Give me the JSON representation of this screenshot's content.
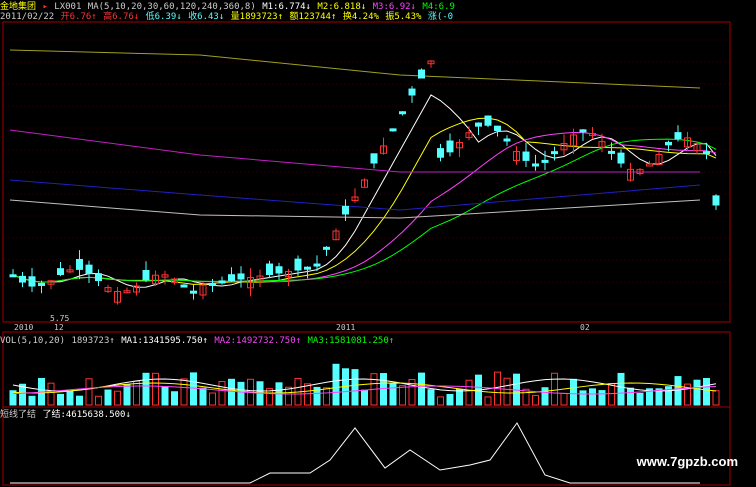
{
  "header": {
    "name": "金地集团",
    "indicator": "LX001",
    "ma_params": "MA(5,10,20,30,60,120,240,360,8)",
    "m1": "M1:6.774↓",
    "m2": "M2:6.818↓",
    "m3": "M3:6.92↓",
    "m4": "M4:6.9",
    "date": "2011/02/22",
    "open": "开6.76↑",
    "high": "高6.76↓",
    "low": "低6.39↓",
    "close": "收6.43↓",
    "volume": "量1893723↑",
    "amount": "额123744↑",
    "turnover": "换4.24%",
    "amplitude": "振5.43%",
    "change": "涨(-0"
  },
  "vol_header": {
    "label": "VOL(5,10,20)",
    "value": "1893723↑",
    "ma1": "MA1:1341595.750↑",
    "ma2": "MA2:1492732.750↑",
    "ma3": "MA3:1581081.250↑"
  },
  "ind_header": {
    "label": "短线了结",
    "value": "了结:4615638.500↓"
  },
  "price_label": "5.75",
  "date_axis": [
    "2010",
    "12",
    "2011",
    "02"
  ],
  "watermark": "www.7gpzb.com",
  "colors": {
    "up": "#ff3232",
    "down": "#54ffff",
    "yellow": "#ffff00",
    "magenta": "#ff44ff",
    "green": "#00ff00",
    "white": "#ffffff"
  }
}
